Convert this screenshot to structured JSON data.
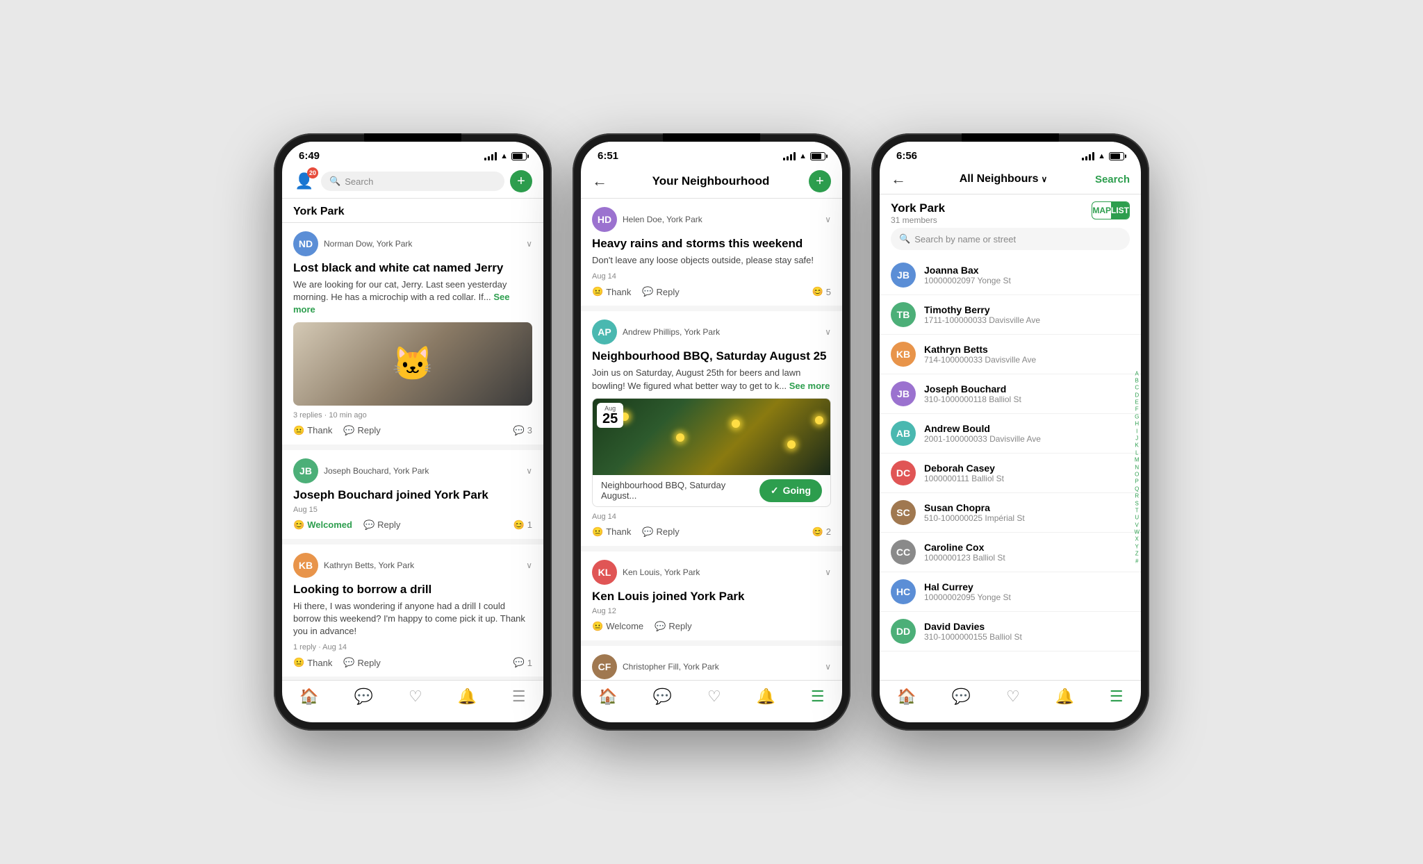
{
  "phone1": {
    "status": {
      "time": "6:49",
      "location_arrow": "▲"
    },
    "search_placeholder": "Search",
    "neighborhood": "York Park",
    "posts": [
      {
        "author": "Norman Dow, York Park",
        "avatar_initials": "ND",
        "avatar_color": "av-blue",
        "title": "Lost black and white cat named Jerry",
        "body": "We are looking for our cat, Jerry. Last seen yesterday morning. He has a microchip with a red collar. If...",
        "see_more": "See more",
        "replies_meta": "3 replies · 10 min ago",
        "has_image": true
      },
      {
        "author": "Joseph Bouchard, York Park",
        "avatar_initials": "JB",
        "avatar_color": "av-green",
        "title": "Joseph Bouchard joined York Park",
        "date": "Aug 15",
        "reaction": "Welcomed",
        "reaction_count": "1",
        "is_welcome": true
      },
      {
        "author": "Kathryn Betts, York Park",
        "avatar_initials": "KB",
        "avatar_color": "av-orange",
        "title": "Looking to borrow a drill",
        "body": "Hi there, I was wondering if anyone had a drill I could borrow this weekend? I'm happy to come pick it up. Thank you in advance!",
        "replies_meta": "1 reply · Aug 14",
        "comment_count": "1"
      }
    ],
    "thank_label": "Thank",
    "reply_label": "Reply",
    "welcomed_label": "Welcomed",
    "tabs": [
      "🏠",
      "💬",
      "❤️",
      "🔔",
      "☰"
    ]
  },
  "phone2": {
    "status": {
      "time": "6:51"
    },
    "title": "Your Neighbourhood",
    "posts": [
      {
        "author": "Helen Doe, York Park",
        "avatar_initials": "HD",
        "avatar_color": "av-purple",
        "title": "Heavy rains and storms this weekend",
        "body": "Don't leave any loose objects outside, please stay safe!",
        "date": "Aug 14",
        "reaction_count": "5"
      },
      {
        "author": "Andrew Phillips, York Park",
        "avatar_initials": "AP",
        "avatar_color": "av-teal",
        "title": "Neighbourhood BBQ, Saturday August 25",
        "body": "Join us on Saturday, August 25th for beers and lawn bowling! We figured what better way to get to k...",
        "see_more": "See more",
        "date": "Aug 14",
        "event_title": "Neighbourhood BBQ, Saturday August...",
        "event_date_month": "Aug",
        "event_date_day": "25",
        "going_label": "Going",
        "reaction_count": "2",
        "has_image": true
      },
      {
        "author": "Ken Louis, York Park",
        "avatar_initials": "KL",
        "avatar_color": "av-red",
        "title": "Ken Louis joined York Park",
        "date": "Aug 12",
        "is_welcome": true
      },
      {
        "author": "Christopher Fill, York Park",
        "avatar_initials": "CF",
        "avatar_color": "av-brown"
      }
    ],
    "thank_label": "Thank",
    "reply_label": "Reply",
    "welcome_label": "Welcome",
    "tabs": [
      "🏠",
      "💬",
      "❤️",
      "🔔",
      "☰"
    ]
  },
  "phone3": {
    "status": {
      "time": "6:56"
    },
    "nav_title": "All Neighbours",
    "search_label": "Search",
    "neighborhood": "York Park",
    "members_count": "31 members",
    "map_label": "MAP",
    "list_label": "LIST",
    "search_placeholder": "Search by name or street",
    "neighbours": [
      {
        "name": "Joanna Bax",
        "address": "10000002097 Yonge St",
        "initials": "JB",
        "color": "av-blue"
      },
      {
        "name": "Timothy Berry",
        "address": "1711-100000033 Davisville Ave",
        "initials": "TB",
        "color": "av-green"
      },
      {
        "name": "Kathryn Betts",
        "address": "714-100000033 Davisville Ave",
        "initials": "KB",
        "color": "av-orange"
      },
      {
        "name": "Joseph Bouchard",
        "address": "310-1000000118 Balliol St",
        "initials": "JB",
        "color": "av-purple"
      },
      {
        "name": "Andrew Bould",
        "address": "2001-100000033 Davisville Ave",
        "initials": "AB",
        "color": "av-teal"
      },
      {
        "name": "Deborah Casey",
        "address": "1000000111 Balliol St",
        "initials": "DC",
        "color": "av-red"
      },
      {
        "name": "Susan Chopra",
        "address": "510-100000025 Impérial St",
        "initials": "SC",
        "color": "av-brown"
      },
      {
        "name": "Caroline Cox",
        "address": "1000000123 Balliol St",
        "initials": "CC",
        "color": "av-gray"
      },
      {
        "name": "Hal Currey",
        "address": "10000002095 Yonge St",
        "initials": "HC",
        "color": "av-blue"
      },
      {
        "name": "David Davies",
        "address": "310-1000000155 Balliol St",
        "initials": "DD",
        "color": "av-green"
      }
    ],
    "alpha_index": [
      "A",
      "B",
      "C",
      "D",
      "E",
      "F",
      "G",
      "H",
      "I",
      "J",
      "K",
      "L",
      "M",
      "N",
      "O",
      "P",
      "Q",
      "R",
      "S",
      "T",
      "U",
      "V",
      "W",
      "X",
      "Y",
      "Z",
      "#"
    ],
    "tabs": [
      "🏠",
      "💬",
      "❤️",
      "🔔",
      "☰"
    ]
  }
}
